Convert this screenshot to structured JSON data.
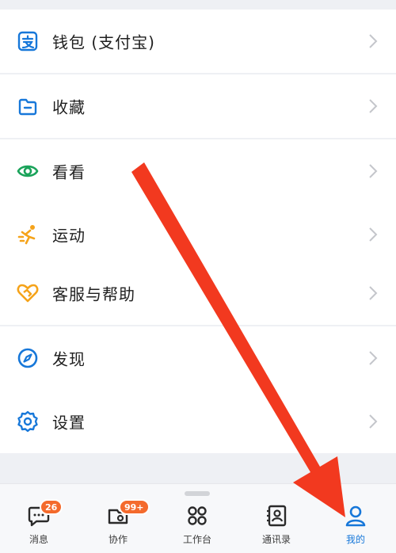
{
  "menu": {
    "items": [
      {
        "label": "钱包 (支付宝)",
        "icon": "alipay-wallet-icon"
      },
      {
        "label": "收藏",
        "icon": "folder-icon"
      },
      {
        "label": "看看",
        "icon": "eye-icon"
      },
      {
        "label": "运动",
        "icon": "running-icon"
      },
      {
        "label": "客服与帮助",
        "icon": "heart-handshake-icon"
      },
      {
        "label": "发现",
        "icon": "compass-icon"
      },
      {
        "label": "设置",
        "icon": "gear-icon"
      }
    ]
  },
  "tabbar": {
    "tabs": [
      {
        "label": "消息",
        "badge": "26",
        "icon": "message-icon"
      },
      {
        "label": "协作",
        "badge": "99+",
        "icon": "collaboration-icon"
      },
      {
        "label": "工作台",
        "icon": "grid-icon"
      },
      {
        "label": "通讯录",
        "icon": "contacts-icon"
      },
      {
        "label": "我的",
        "icon": "person-icon",
        "active": true
      }
    ]
  },
  "colors": {
    "accent_blue": "#1677d9",
    "badge_orange": "#f46a2c",
    "arrow_red": "#f2391f",
    "green": "#1aa35a",
    "orange": "#f5a31a"
  }
}
